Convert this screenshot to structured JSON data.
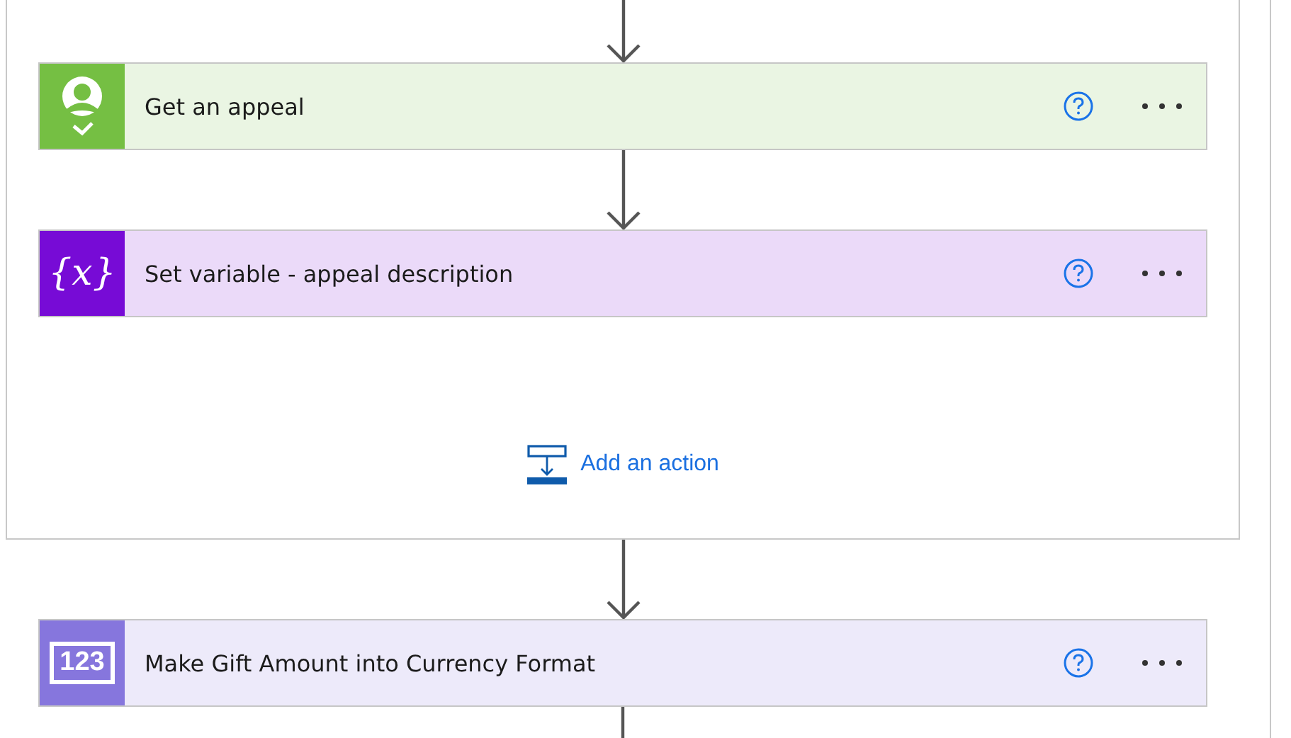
{
  "scope": {
    "actions": [
      {
        "title": "Get an appeal",
        "kind": "person",
        "color": "#75bf43"
      },
      {
        "title": "Set variable - appeal description",
        "kind": "variable",
        "color": "#770bd6",
        "icon_text": "{x}"
      }
    ],
    "add_action": {
      "label": "Add an action"
    }
  },
  "after": [
    {
      "title": "Make Gift Amount into Currency Format",
      "kind": "number",
      "color": "#8676dd",
      "icon_text": "123"
    }
  ]
}
